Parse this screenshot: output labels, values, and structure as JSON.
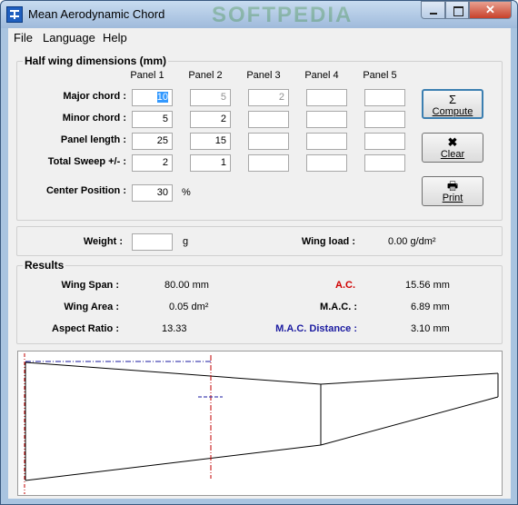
{
  "window": {
    "title": "Mean Aerodynamic Chord",
    "watermark": "SOFTPEDIA"
  },
  "menu": {
    "file": "File",
    "language": "Language",
    "help": "Help"
  },
  "dimensions": {
    "title": "Half wing dimensions (mm)",
    "panels": [
      "Panel 1",
      "Panel 2",
      "Panel 3",
      "Panel 4",
      "Panel 5"
    ],
    "rows": [
      {
        "label": "Major chord :",
        "values": [
          "10",
          "5",
          "2",
          "",
          ""
        ]
      },
      {
        "label": "Minor chord :",
        "values": [
          "5",
          "2",
          "",
          "",
          ""
        ]
      },
      {
        "label": "Panel length :",
        "values": [
          "25",
          "15",
          "",
          "",
          ""
        ]
      },
      {
        "label": "Total Sweep +/- :",
        "values": [
          "2",
          "1",
          "",
          "",
          ""
        ]
      }
    ],
    "center_label": "Center Position :",
    "center_value": "30",
    "center_unit": "%"
  },
  "buttons": {
    "compute": "Compute",
    "clear": "Clear",
    "print": "Print"
  },
  "icons": {
    "compute": "sigma-icon",
    "clear": "close-icon",
    "print": "printer-icon",
    "app": "app-icon"
  },
  "weight": {
    "label": "Weight :",
    "value": "",
    "unit": "g",
    "wing_load_label": "Wing load :",
    "wing_load_value": "0.00 g/dm²"
  },
  "results": {
    "title": "Results",
    "wing_span_label": "Wing Span :",
    "wing_span_value": "80.00 mm",
    "wing_area_label": "Wing Area :",
    "wing_area_value": "0.05 dm²",
    "aspect_ratio_label": "Aspect Ratio :",
    "aspect_ratio_value": "13.33",
    "ac_label": "A.C.",
    "ac_value": "15.56 mm",
    "mac_label": "M.A.C. :",
    "mac_value": "6.89 mm",
    "mac_distance_label": "M.A.C. Distance :",
    "mac_distance_value": "3.10 mm"
  },
  "colors": {
    "ac": "#d00000",
    "mac_distance": "#1a1aa0",
    "selection": "#3399ff"
  }
}
